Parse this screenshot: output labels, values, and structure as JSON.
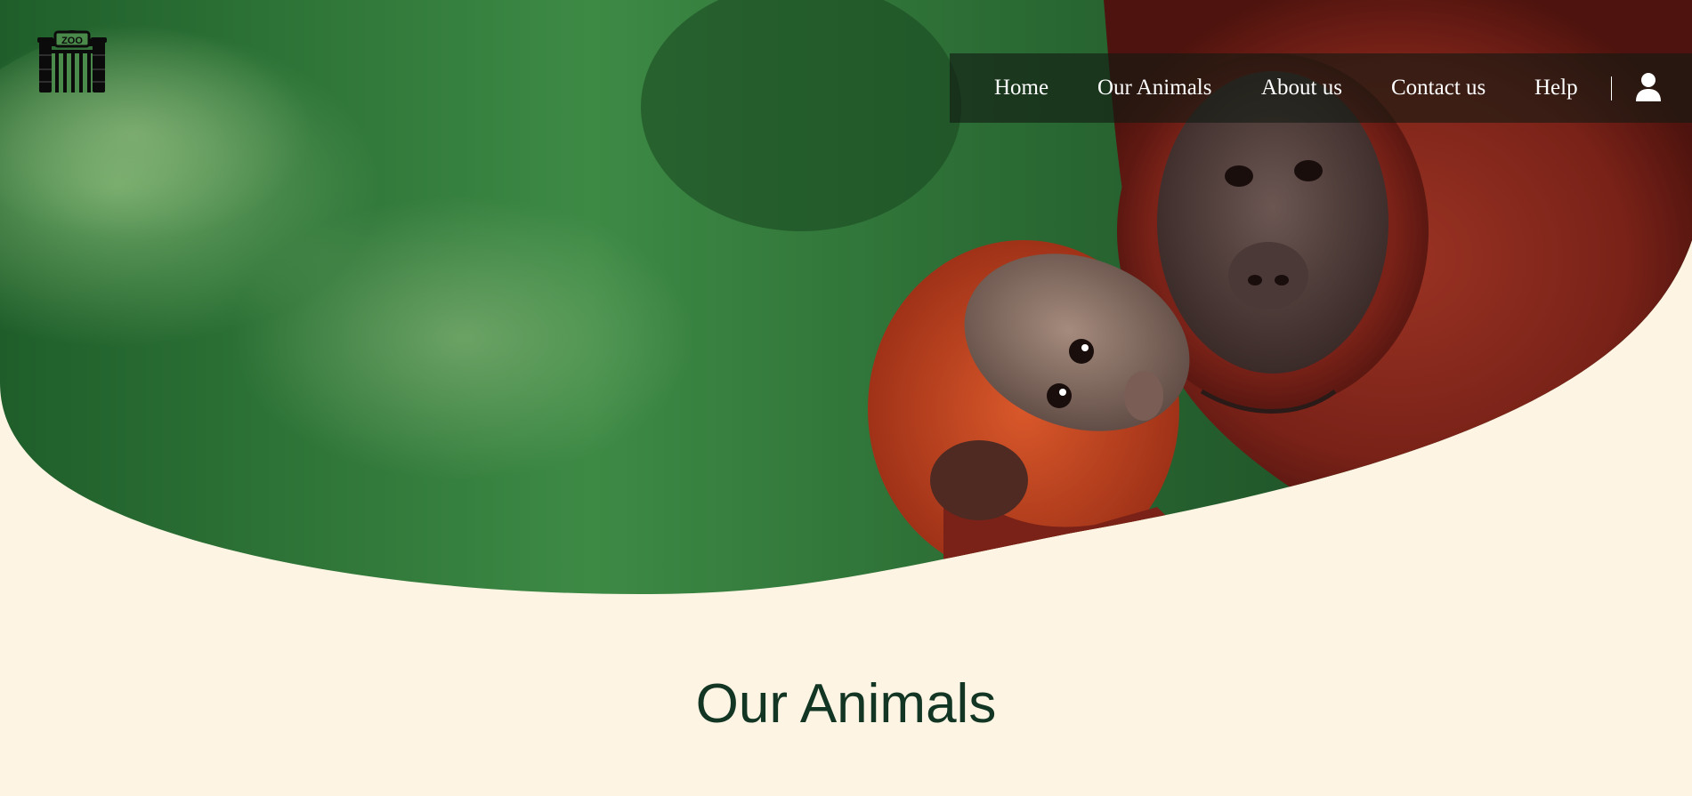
{
  "logo": {
    "icon": "zoo-gate-icon",
    "sign_text": "ZOO"
  },
  "nav": {
    "items": [
      {
        "label": "Home"
      },
      {
        "label": "Our Animals"
      },
      {
        "label": "About us"
      },
      {
        "label": "Contact us"
      },
      {
        "label": "Help"
      }
    ],
    "user_icon": "user-icon"
  },
  "main": {
    "title": "Our Animals"
  },
  "colors": {
    "page_background": "#fdf4e3",
    "title_text": "#123524",
    "nav_background": "rgba(18,26,18,0.62)",
    "nav_text": "#ffffff"
  }
}
